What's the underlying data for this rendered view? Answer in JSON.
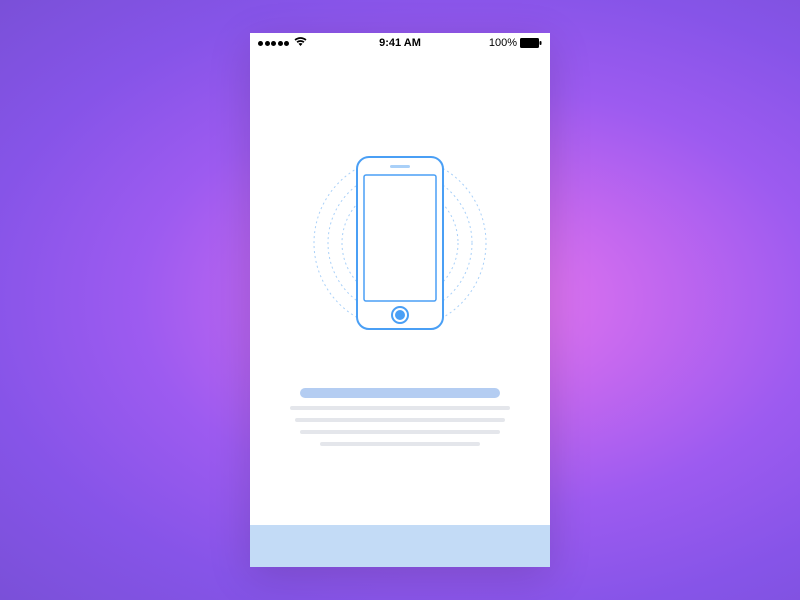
{
  "status_bar": {
    "time": "9:41 AM",
    "battery_percent": "100%",
    "signal_strength": 5,
    "wifi": true
  },
  "illustration": {
    "type": "phone-outline",
    "accent_color": "#4a9ff5"
  },
  "placeholder": {
    "has_title": true,
    "body_lines": 4
  }
}
